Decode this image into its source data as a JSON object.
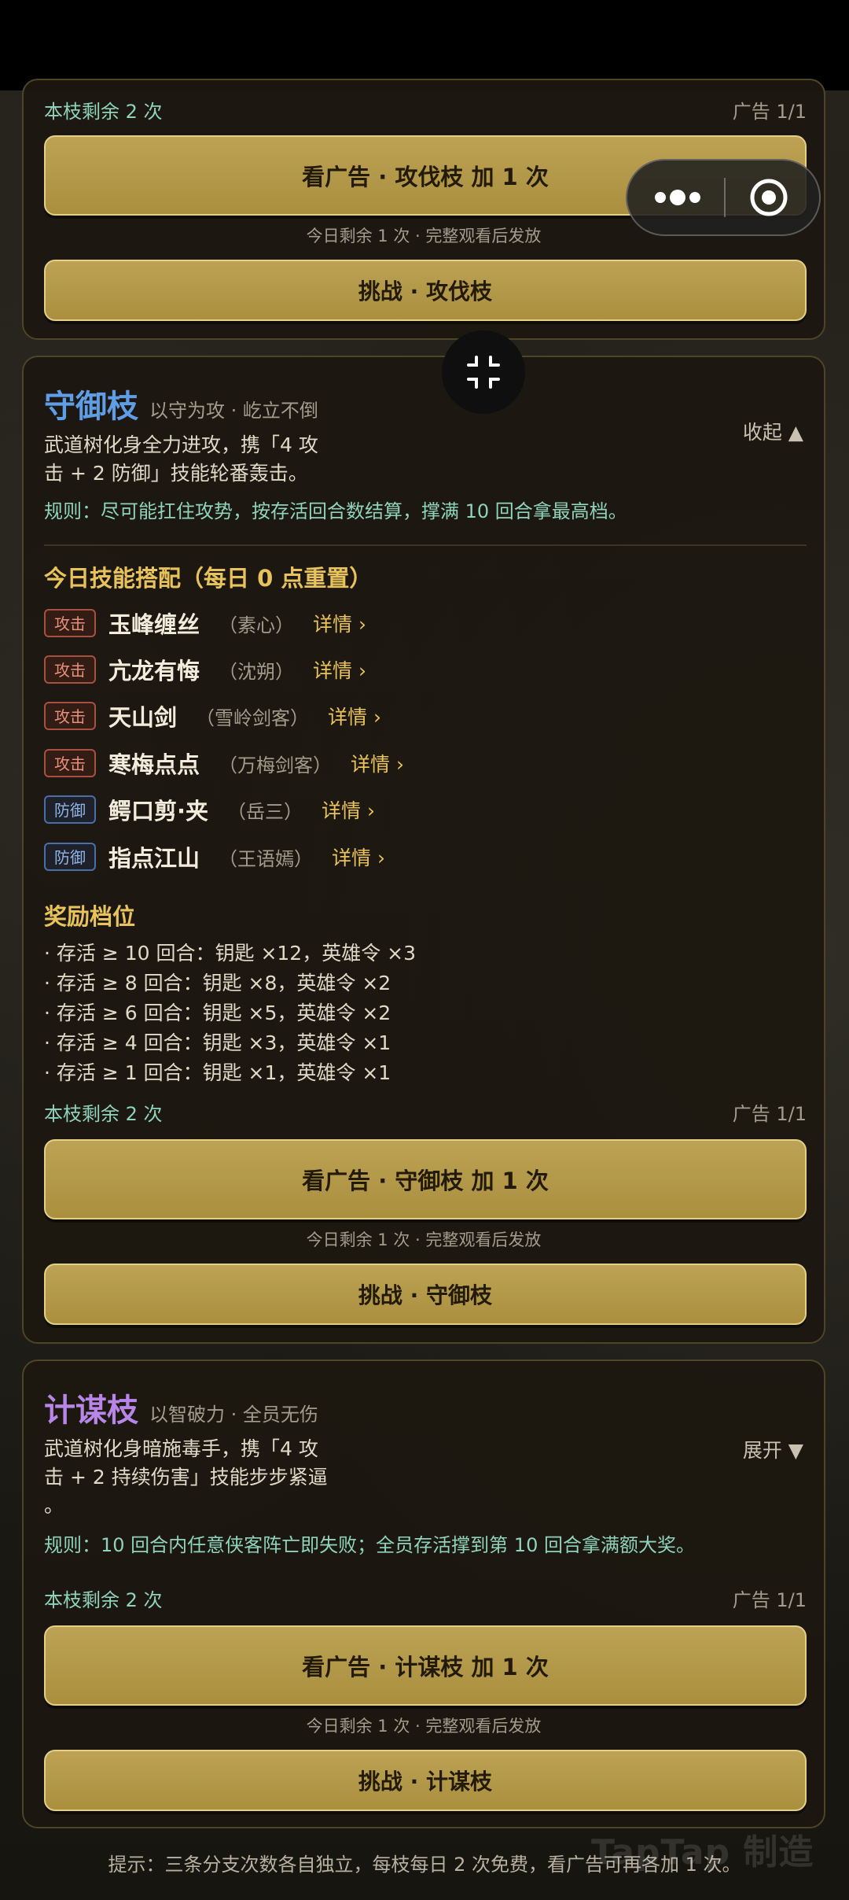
{
  "top_panel": {
    "remain": "本枝剩余 2 次",
    "ad_count": "广告 1/1",
    "ad_button": "看广告 · 攻伐枝 加 1 次",
    "ad_note": "今日剩余 1 次 · 完整观看后发放",
    "challenge_button": "挑战 · 攻伐枝"
  },
  "defense_panel": {
    "title": "守御枝",
    "subtitle": "以守为攻 · 屹立不倒",
    "toggle": "收起 ▲",
    "desc_line1": "武道树化身全力进攻，携「4 攻",
    "desc_line2": "击 + 2 防御」技能轮番轰击。",
    "rule": "规则：尽可能扛住攻势，按存活回合数结算，撑满 10 回合拿最高档。",
    "skills_heading": "今日技能搭配（每日 0 点重置）",
    "skills": [
      {
        "tag": "攻击",
        "type": "atk",
        "name": "玉峰缠丝",
        "source": "（素心）",
        "link": "详情 ›"
      },
      {
        "tag": "攻击",
        "type": "atk",
        "name": "亢龙有悔",
        "source": "（沈朔）",
        "link": "详情 ›"
      },
      {
        "tag": "攻击",
        "type": "atk",
        "name": "天山剑",
        "source": "（雪岭剑客）",
        "link": "详情 ›"
      },
      {
        "tag": "攻击",
        "type": "atk",
        "name": "寒梅点点",
        "source": "（万梅剑客）",
        "link": "详情 ›"
      },
      {
        "tag": "防御",
        "type": "def",
        "name": "鳄口剪·夹",
        "source": "（岳三）",
        "link": "详情 ›"
      },
      {
        "tag": "防御",
        "type": "def",
        "name": "指点江山",
        "source": "（王语嫣）",
        "link": "详情 ›"
      }
    ],
    "rewards_heading": "奖励档位",
    "rewards": [
      "· 存活 ≥ 10 回合：钥匙 ×12，英雄令 ×3",
      "· 存活 ≥ 8 回合：钥匙 ×8，英雄令 ×2",
      "· 存活 ≥ 6 回合：钥匙 ×5，英雄令 ×2",
      "· 存活 ≥ 4 回合：钥匙 ×3，英雄令 ×1",
      "· 存活 ≥ 1 回合：钥匙 ×1，英雄令 ×1"
    ],
    "remain": "本枝剩余 2 次",
    "ad_count": "广告 1/1",
    "ad_button": "看广告 · 守御枝 加 1 次",
    "ad_note": "今日剩余 1 次 · 完整观看后发放",
    "challenge_button": "挑战 · 守御枝"
  },
  "strategy_panel": {
    "title": "计谋枝",
    "subtitle": "以智破力 · 全员无伤",
    "toggle": "展开 ▼",
    "desc_line1": "武道树化身暗施毒手，携「4 攻",
    "desc_line2": "击 + 2 持续伤害」技能步步紧逼",
    "desc_line3": "。",
    "rule": "规则：10 回合内任意侠客阵亡即失败；全员存活撑到第 10 回合拿满额大奖。",
    "remain": "本枝剩余 2 次",
    "ad_count": "广告 1/1",
    "ad_button": "看广告 · 计谋枝 加 1 次",
    "ad_note": "今日剩余 1 次 · 完整观看后发放",
    "challenge_button": "挑战 · 计谋枝"
  },
  "footer_hint": "提示：三条分支次数各自独立，每枝每日 2 次免费，看广告可再各加 1 次。",
  "watermark": "TapTap 制造",
  "colors": {
    "gold_button": "#b59a4c",
    "defense_title": "#5f9ee6",
    "strategy_title": "#b786e6",
    "teal_text": "#8fd3bd",
    "link": "#e8c25a"
  }
}
